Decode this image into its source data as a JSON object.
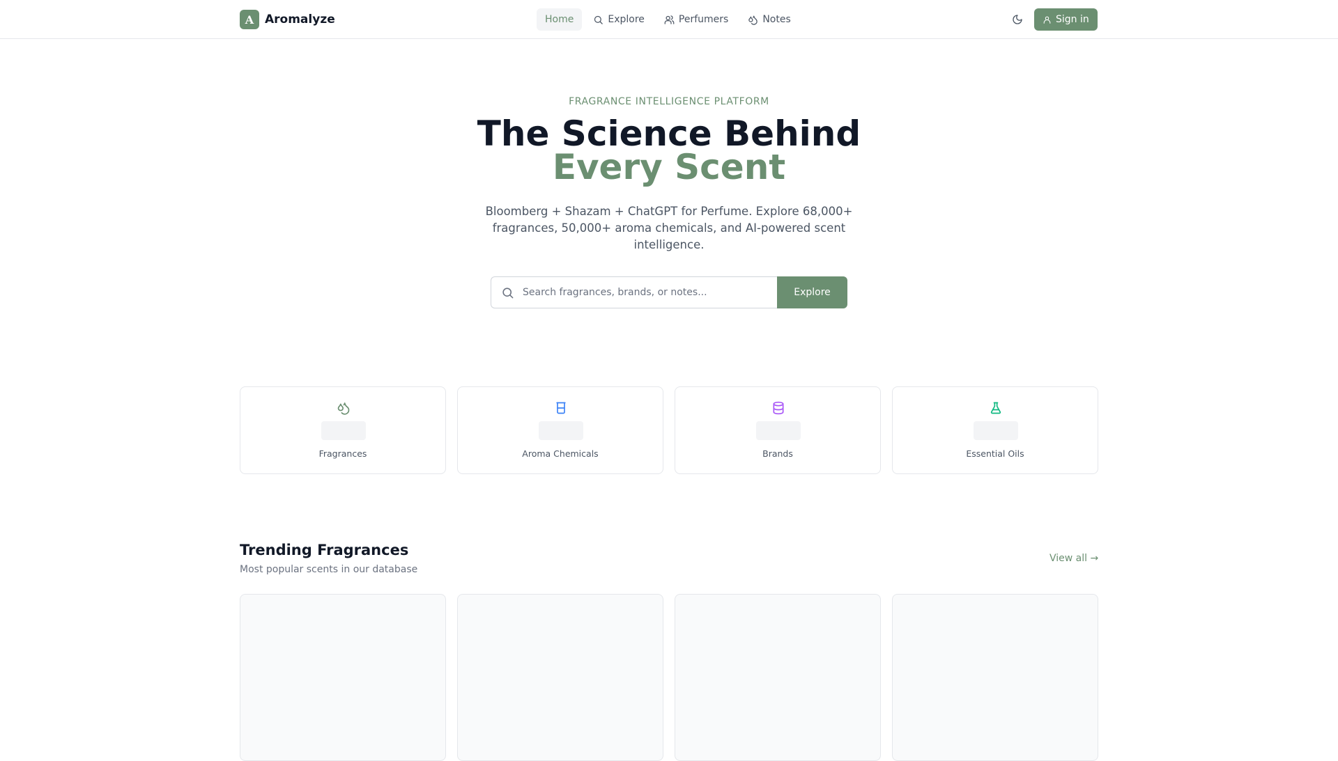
{
  "brand": {
    "name": "Aromalyze",
    "mark": "A",
    "color": "#6b8f71"
  },
  "nav": {
    "items": [
      {
        "label": "Home",
        "icon": "none",
        "active": true
      },
      {
        "label": "Explore",
        "icon": "search-icon"
      },
      {
        "label": "Perfumers",
        "icon": "users-icon"
      },
      {
        "label": "Notes",
        "icon": "droplets-icon"
      }
    ],
    "theme_toggle_icon": "moon-icon",
    "signin_label": "Sign in"
  },
  "hero": {
    "eyebrow": "FRAGRANCE INTELLIGENCE PLATFORM",
    "title_line1": "The Science Behind",
    "title_line2": "Every Scent",
    "subtitle": "Bloomberg + Shazam + ChatGPT for Perfume. Explore 68,000+ fragrances, 50,000+ aroma chemicals, and AI-powered scent intelligence.",
    "search_placeholder": "Search fragrances, brands, or notes...",
    "search_value": "",
    "search_button": "Explore"
  },
  "stats": [
    {
      "label": "Fragrances",
      "icon": "droplets-icon",
      "color": "#6b8f71"
    },
    {
      "label": "Aroma Chemicals",
      "icon": "beaker-icon",
      "color": "#3b82f6"
    },
    {
      "label": "Brands",
      "icon": "database-icon",
      "color": "#a855f7"
    },
    {
      "label": "Essential Oils",
      "icon": "flask-icon",
      "color": "#10b981"
    }
  ],
  "trending": {
    "title": "Trending Fragrances",
    "subtitle": "Most popular scents in our database",
    "view_all": "View all →"
  }
}
